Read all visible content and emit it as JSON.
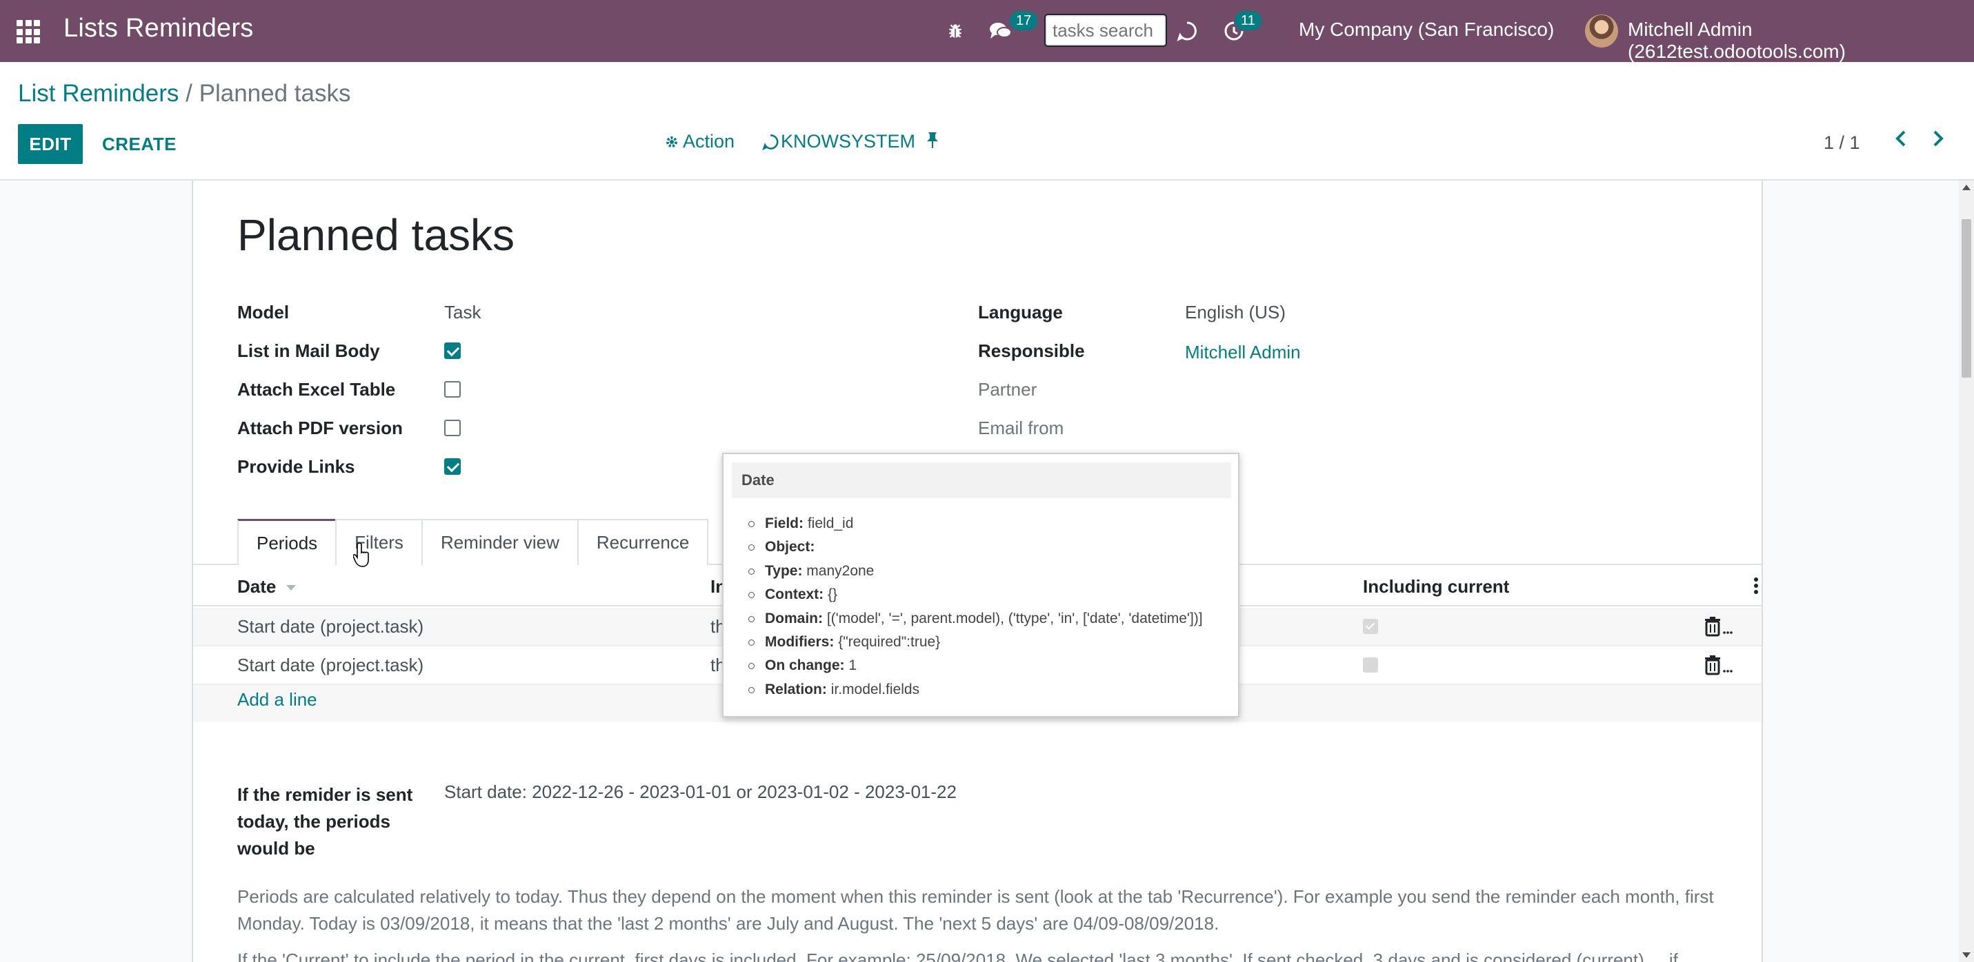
{
  "navbar": {
    "app_title": "Lists Reminders",
    "chat_badge": "17",
    "search_placeholder": "tasks search",
    "activity_badge": "11",
    "company": "My Company (San Francisco)",
    "user": "Mitchell Admin (2612test.odootools.com)",
    "brand_color": "#714b67"
  },
  "control_panel": {
    "breadcrumb_parent": "List Reminders",
    "breadcrumb_separator": "/",
    "breadcrumb_current": "Planned tasks",
    "edit_label": "EDIT",
    "create_label": "CREATE",
    "action_label": "Action",
    "knowsystem_label": "KNOWSYSTEM",
    "pager": "1 / 1",
    "accent_color": "#017e84"
  },
  "form": {
    "title": "Planned tasks",
    "left_fields": [
      {
        "label": "Model",
        "value": "Task"
      },
      {
        "label": "List in Mail Body",
        "checked": true
      },
      {
        "label": "Attach Excel Table",
        "checked": false
      },
      {
        "label": "Attach PDF version",
        "checked": false
      },
      {
        "label": "Provide Links",
        "checked": true
      }
    ],
    "right_fields": [
      {
        "label": "Language",
        "value": "English (US)"
      },
      {
        "label": "Responsible",
        "value": "Mitchell Admin"
      },
      {
        "label": "Partner",
        "value": ""
      },
      {
        "label": "Email from",
        "value": ""
      }
    ],
    "tabs": [
      "Periods",
      "Filters",
      "Reminder view",
      "Recurrence"
    ],
    "active_tab": "Periods",
    "list": {
      "columns": {
        "date": "Date",
        "interval": "In",
        "including_current": "Including current"
      },
      "rows": [
        {
          "date": "Start date (project.task)",
          "interval": "th",
          "including_current": true
        },
        {
          "date": "Start date (project.task)",
          "interval": "th",
          "including_current": false
        }
      ],
      "add_line": "Add a line"
    },
    "periods_note_label": "If the remider is sent today, the periods would be",
    "periods_note_value": "Start date: 2022-12-26 - 2023-01-01 or 2023-01-02 - 2023-01-22",
    "help_text": "Periods are calculated relatively to today. Thus they depend on the moment when this reminder is sent (look at the tab 'Recurrence'). For example you send the reminder each month, first Monday. Today is 03/09/2018, it means that the 'last 2 months' are July and August. The 'next 5 days' are 04/09-08/09/2018.",
    "help_text_2": "If the 'Current' to include the period in the current, first days is included. For example: 25/09/2018. We selected 'last 3 months'. If sent checked, 3 days and is considered (current) ... if"
  },
  "tooltip": {
    "title": "Date",
    "items": [
      {
        "key": "Field:",
        "value": "field_id"
      },
      {
        "key": "Object:",
        "value": ""
      },
      {
        "key": "Type:",
        "value": "many2one"
      },
      {
        "key": "Context:",
        "value": "{}"
      },
      {
        "key": "Domain:",
        "value": "[('model', '=', parent.model), ('ttype', 'in', ['date', 'datetime'])]"
      },
      {
        "key": "Modifiers:",
        "value": "{\"required\":true}"
      },
      {
        "key": "On change:",
        "value": "1"
      },
      {
        "key": "Relation:",
        "value": "ir.model.fields"
      }
    ]
  }
}
